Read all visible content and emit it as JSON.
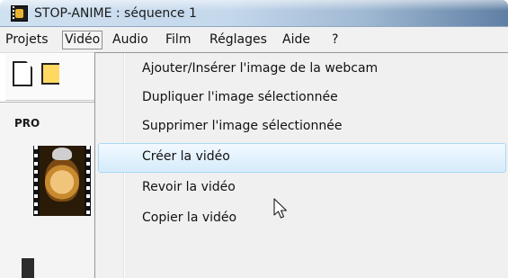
{
  "window": {
    "title": "STOP-ANIME : séquence 1"
  },
  "menubar": {
    "items": [
      "Projets",
      "Vidéo",
      "Audio",
      "Film",
      "Réglages",
      "Aide",
      "?"
    ],
    "open_item": "Vidéo"
  },
  "background": {
    "panel_label": "PRO"
  },
  "dropdown": {
    "items": [
      "Ajouter/Insérer l'image de la webcam",
      "Dupliquer l'image sélectionnée",
      "Supprimer l'image sélectionnée",
      "Créer la vidéo",
      "Revoir la vidéo",
      "Copier la vidéo"
    ],
    "highlighted": "Créer la vidéo"
  },
  "colors": {
    "highlight_border": "#a8d8f6",
    "highlight_fill": "#e3f2fd",
    "menu_background": "#f0f0f0"
  },
  "icons": [
    "app-icon",
    "new-document-icon",
    "open-folder-icon",
    "mouse-cursor-icon"
  ]
}
